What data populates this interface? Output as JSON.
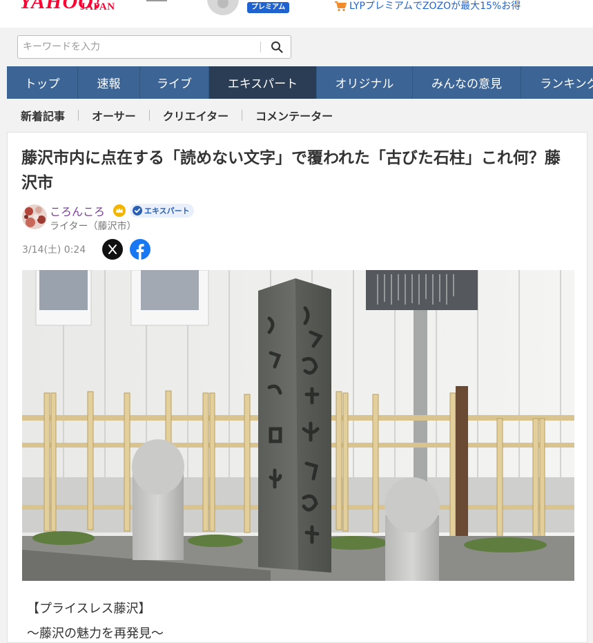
{
  "header": {
    "logo": "YAHOO!",
    "logo_sub": "JAPAN",
    "premium_badge": "プレミアム",
    "promo_text": "LYPプレミアムでZOZOが最大15%お得"
  },
  "search": {
    "placeholder": "キーワードを入力"
  },
  "main_nav": {
    "tabs": [
      {
        "label": "トップ"
      },
      {
        "label": "速報"
      },
      {
        "label": "ライブ"
      },
      {
        "label": "エキスパート"
      },
      {
        "label": "オリジナル"
      },
      {
        "label": "みんなの意見"
      },
      {
        "label": "ランキング"
      }
    ],
    "active_index": 3
  },
  "sub_nav": {
    "items": [
      {
        "label": "新着記事"
      },
      {
        "label": "オーサー"
      },
      {
        "label": "クリエイター"
      },
      {
        "label": "コメンテーター"
      }
    ]
  },
  "article": {
    "title": "藤沢市内に点在する「読めない文字」で覆われた「古びた石柱」これ何？藤沢市",
    "author_name": "ころんころ",
    "expert_badge": "エキスパート",
    "author_role": "ライター（藤沢市）",
    "date": "3/14(土) 0:24",
    "intro_line1": "【プライスレス藤沢】",
    "intro_line2": "〜藤沢の魅力を再発見〜"
  },
  "colors": {
    "brand_red": "#ff0033",
    "nav_blue": "#3c6596",
    "nav_active": "#2b3d54",
    "link_blue": "#1e63d0",
    "author_purple": "#7a3b9a"
  },
  "icons": [
    "cart-icon",
    "search-icon",
    "crown-icon",
    "check-icon",
    "x-logo-icon",
    "facebook-icon"
  ]
}
